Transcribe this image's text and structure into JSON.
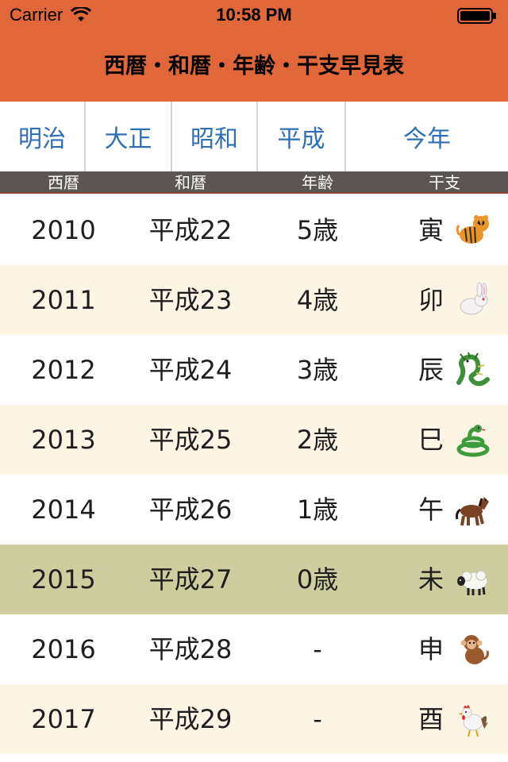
{
  "status": {
    "carrier": "Carrier",
    "time": "10:58 PM"
  },
  "nav": {
    "title": "西暦・和暦・年齢・干支早見表"
  },
  "segments": [
    "明治",
    "大正",
    "昭和",
    "平成",
    "今年"
  ],
  "columns": {
    "seireki": "西暦",
    "wareki": "和暦",
    "nenrei": "年齢",
    "eto": "干支"
  },
  "rows": [
    {
      "year": "2010",
      "era": "平成22",
      "age": "5歳",
      "eto": "寅",
      "icon": "tiger-icon"
    },
    {
      "year": "2011",
      "era": "平成23",
      "age": "4歳",
      "eto": "卯",
      "icon": "rabbit-icon"
    },
    {
      "year": "2012",
      "era": "平成24",
      "age": "3歳",
      "eto": "辰",
      "icon": "dragon-icon"
    },
    {
      "year": "2013",
      "era": "平成25",
      "age": "2歳",
      "eto": "巳",
      "icon": "snake-icon"
    },
    {
      "year": "2014",
      "era": "平成26",
      "age": "1歳",
      "eto": "午",
      "icon": "horse-icon"
    },
    {
      "year": "2015",
      "era": "平成27",
      "age": "0歳",
      "eto": "未",
      "icon": "sheep-icon"
    },
    {
      "year": "2016",
      "era": "平成28",
      "age": "-",
      "eto": "申",
      "icon": "monkey-icon"
    },
    {
      "year": "2017",
      "era": "平成29",
      "age": "-",
      "eto": "酉",
      "icon": "rooster-icon"
    }
  ],
  "colors": {
    "header": "#e0673a",
    "segment_text": "#2e6fb6",
    "column_header": "#5b5654",
    "row_alt": "#fdf5e4",
    "row_current": "#cdcda0"
  }
}
